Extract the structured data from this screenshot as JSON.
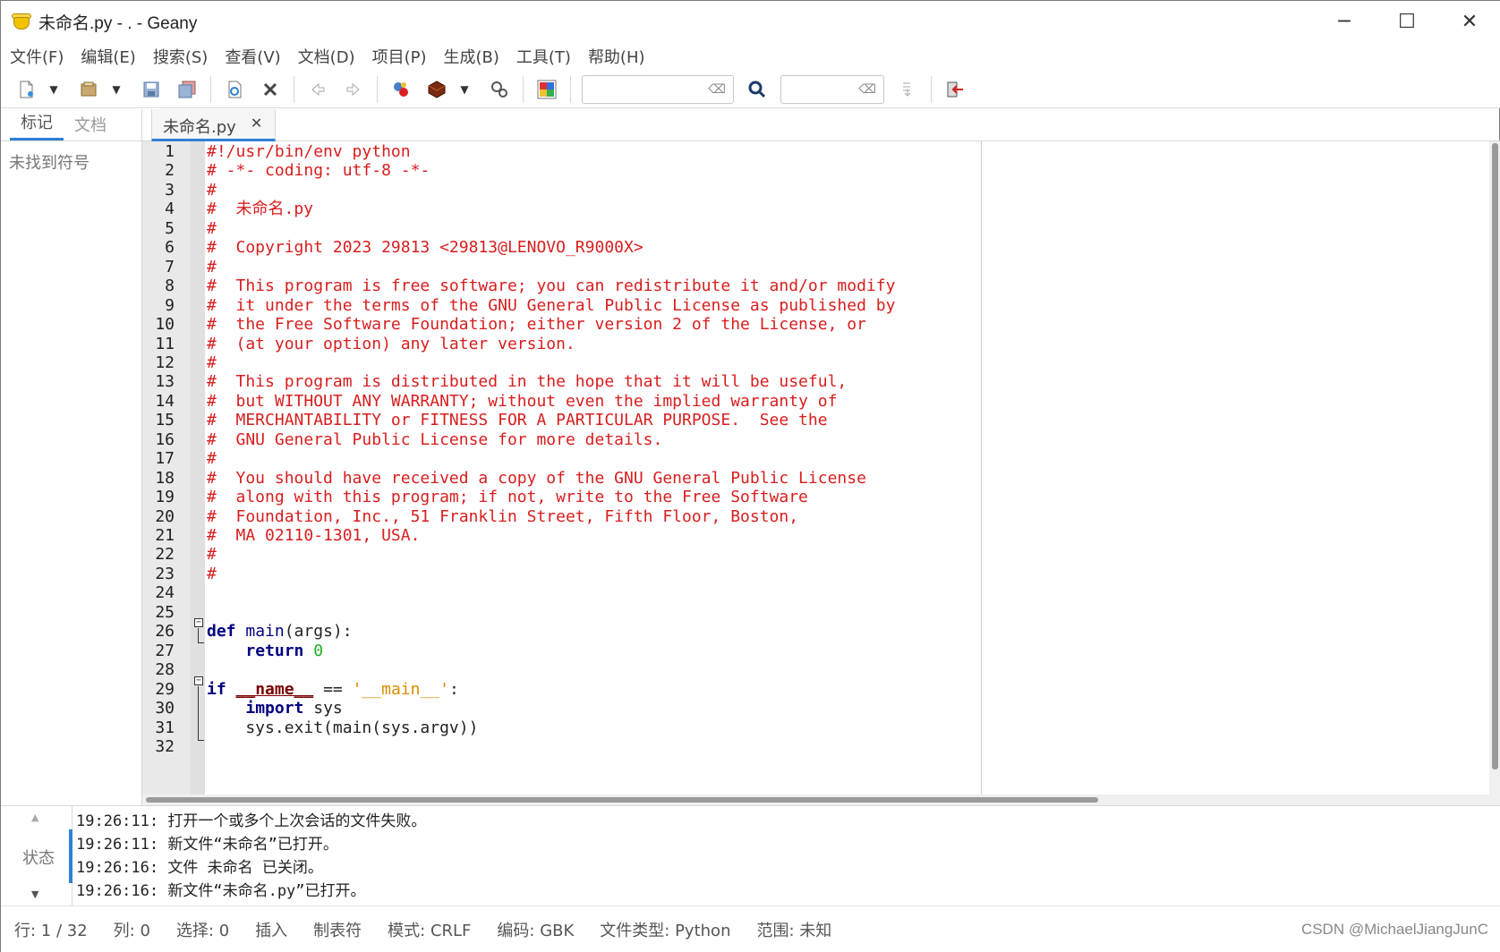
{
  "window": {
    "title": "未命名.py - . - Geany",
    "controls": {
      "minimize": "─",
      "maximize": "☐",
      "close": "✕"
    }
  },
  "menu": [
    "文件(F)",
    "编辑(E)",
    "搜索(S)",
    "查看(V)",
    "文档(D)",
    "项目(P)",
    "生成(B)",
    "工具(T)",
    "帮助(H)"
  ],
  "toolbar": {
    "search_value": "",
    "goto_value": "",
    "icons": [
      "new-file-icon",
      "open-file-icon",
      "save-icon",
      "save-all-icon",
      "reload-icon",
      "close-file-icon",
      "back-icon",
      "forward-icon",
      "compile-icon",
      "build-icon",
      "run-icon",
      "color-chooser-icon",
      "find-icon",
      "jump-to-line-icon",
      "quit-icon"
    ]
  },
  "sidebar": {
    "tabs": [
      "标记",
      "文档"
    ],
    "empty_text": "未找到符号"
  },
  "editor": {
    "tab_label": "未命名.py",
    "tab_close": "✕",
    "lines": [
      {
        "n": "1",
        "segs": [
          {
            "t": "#!/usr/bin/env python",
            "c": "c"
          }
        ]
      },
      {
        "n": "2",
        "segs": [
          {
            "t": "# -*- coding: utf-8 -*-",
            "c": "c"
          }
        ]
      },
      {
        "n": "3",
        "segs": [
          {
            "t": "#",
            "c": "c"
          }
        ]
      },
      {
        "n": "4",
        "segs": [
          {
            "t": "#  未命名.py",
            "c": "c"
          }
        ]
      },
      {
        "n": "5",
        "segs": [
          {
            "t": "#",
            "c": "c"
          }
        ]
      },
      {
        "n": "6",
        "segs": [
          {
            "t": "#  Copyright 2023 29813 <29813@LENOVO_R9000X>",
            "c": "c"
          }
        ]
      },
      {
        "n": "7",
        "segs": [
          {
            "t": "#",
            "c": "c"
          }
        ]
      },
      {
        "n": "8",
        "segs": [
          {
            "t": "#  This program is free software; you can redistribute it and/or modify",
            "c": "c"
          }
        ]
      },
      {
        "n": "9",
        "segs": [
          {
            "t": "#  it under the terms of the GNU General Public License as published by",
            "c": "c"
          }
        ]
      },
      {
        "n": "10",
        "segs": [
          {
            "t": "#  the Free Software Foundation; either version 2 of the License, or",
            "c": "c"
          }
        ]
      },
      {
        "n": "11",
        "segs": [
          {
            "t": "#  (at your option) any later version.",
            "c": "c"
          }
        ]
      },
      {
        "n": "12",
        "segs": [
          {
            "t": "#",
            "c": "c"
          }
        ]
      },
      {
        "n": "13",
        "segs": [
          {
            "t": "#  This program is distributed in the hope that it will be useful,",
            "c": "c"
          }
        ]
      },
      {
        "n": "14",
        "segs": [
          {
            "t": "#  but WITHOUT ANY WARRANTY; without even the implied warranty of",
            "c": "c"
          }
        ]
      },
      {
        "n": "15",
        "segs": [
          {
            "t": "#  MERCHANTABILITY or FITNESS FOR A PARTICULAR PURPOSE.  See the",
            "c": "c"
          }
        ]
      },
      {
        "n": "16",
        "segs": [
          {
            "t": "#  GNU General Public License for more details.",
            "c": "c"
          }
        ]
      },
      {
        "n": "17",
        "segs": [
          {
            "t": "#",
            "c": "c"
          }
        ]
      },
      {
        "n": "18",
        "segs": [
          {
            "t": "#  You should have received a copy of the GNU General Public License",
            "c": "c"
          }
        ]
      },
      {
        "n": "19",
        "segs": [
          {
            "t": "#  along with this program; if not, write to the Free Software",
            "c": "c"
          }
        ]
      },
      {
        "n": "20",
        "segs": [
          {
            "t": "#  Foundation, Inc., 51 Franklin Street, Fifth Floor, Boston,",
            "c": "c"
          }
        ]
      },
      {
        "n": "21",
        "segs": [
          {
            "t": "#  MA 02110-1301, USA.",
            "c": "c"
          }
        ]
      },
      {
        "n": "22",
        "segs": [
          {
            "t": "#",
            "c": "c"
          }
        ]
      },
      {
        "n": "23",
        "segs": [
          {
            "t": "#",
            "c": "c"
          }
        ]
      },
      {
        "n": "24",
        "segs": []
      },
      {
        "n": "25",
        "segs": []
      },
      {
        "n": "26",
        "segs": [
          {
            "t": "def",
            "c": "kw"
          },
          {
            "t": " ",
            "c": "plain"
          },
          {
            "t": "main",
            "c": "fn"
          },
          {
            "t": "(args):",
            "c": "plain"
          }
        ]
      },
      {
        "n": "27",
        "segs": [
          {
            "t": "    ",
            "c": "plain"
          },
          {
            "t": "return",
            "c": "kw"
          },
          {
            "t": " ",
            "c": "plain"
          },
          {
            "t": "0",
            "c": "num"
          }
        ]
      },
      {
        "n": "28",
        "segs": []
      },
      {
        "n": "29",
        "segs": [
          {
            "t": "if",
            "c": "kw"
          },
          {
            "t": " ",
            "c": "plain"
          },
          {
            "t": "__name__",
            "c": "dn"
          },
          {
            "t": " == ",
            "c": "plain"
          },
          {
            "t": "'__main__'",
            "c": "str"
          },
          {
            "t": ":",
            "c": "plain"
          }
        ]
      },
      {
        "n": "30",
        "segs": [
          {
            "t": "    ",
            "c": "plain"
          },
          {
            "t": "import",
            "c": "kw"
          },
          {
            "t": " sys",
            "c": "plain"
          }
        ]
      },
      {
        "n": "31",
        "segs": [
          {
            "t": "    sys.exit(main(sys.argv))",
            "c": "plain"
          }
        ]
      },
      {
        "n": "32",
        "segs": []
      }
    ]
  },
  "messages": {
    "tab_label": "状态",
    "lines": [
      "19:26:11: 打开一个或多个上次会话的文件失败。",
      "19:26:11: 新文件“未命名”已打开。",
      "19:26:16: 文件 未命名 已关闭。",
      "19:26:16: 新文件“未命名.py”已打开。"
    ]
  },
  "status": {
    "line": "行: 1 / 32",
    "col": "列: 0",
    "sel": "选择: 0",
    "ins": "插入",
    "tab": "制表符",
    "mode": "模式: CRLF",
    "encoding": "编码: GBK",
    "filetype": "文件类型: Python",
    "scope": "范围: 未知"
  },
  "watermark": "CSDN @MichaelJiangJunC",
  "colors": {
    "comment": "#d81e1e",
    "keyword": "#000080",
    "number": "#20b020",
    "string": "#e08a00",
    "accent": "#2f7fd6"
  }
}
